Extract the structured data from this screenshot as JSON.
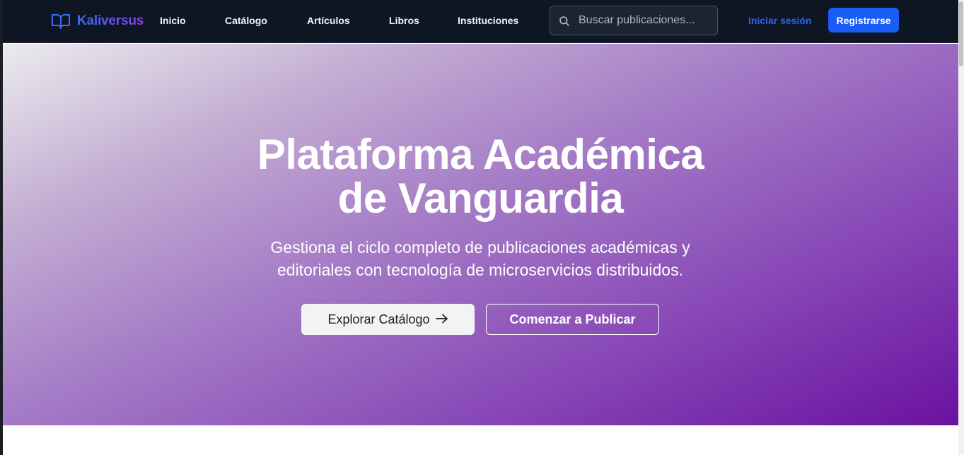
{
  "brand": {
    "name": "Kaliversus",
    "icon": "book-open-icon"
  },
  "nav": {
    "items": [
      {
        "label": "Inicio"
      },
      {
        "label": "Catálogo"
      },
      {
        "label": "Artículos"
      },
      {
        "label": "Libros"
      },
      {
        "label": "Instituciones"
      }
    ]
  },
  "search": {
    "placeholder": "Buscar publicaciones...",
    "value": "",
    "icon": "search-icon"
  },
  "auth": {
    "login_label": "Iniciar sesión",
    "register_label": "Registrarse"
  },
  "hero": {
    "title_line1": "Plataforma Académica",
    "title_line2": "de Vanguardia",
    "subtitle_line1": "Gestiona el ciclo completo de publicaciones académicas y",
    "subtitle_line2": "editoriales con tecnología de microservicios distribuidos.",
    "primary_cta": "Explorar Catálogo",
    "primary_cta_icon": "arrow-right-icon",
    "secondary_cta": "Comenzar a Publicar"
  },
  "colors": {
    "navbar_bg": "#0f1623",
    "accent_blue": "#1a5cf5",
    "brand_gradient_start": "#3b6cf5",
    "brand_gradient_end": "#8a3ee8",
    "hero_gradient_end": "#6a12a0"
  }
}
